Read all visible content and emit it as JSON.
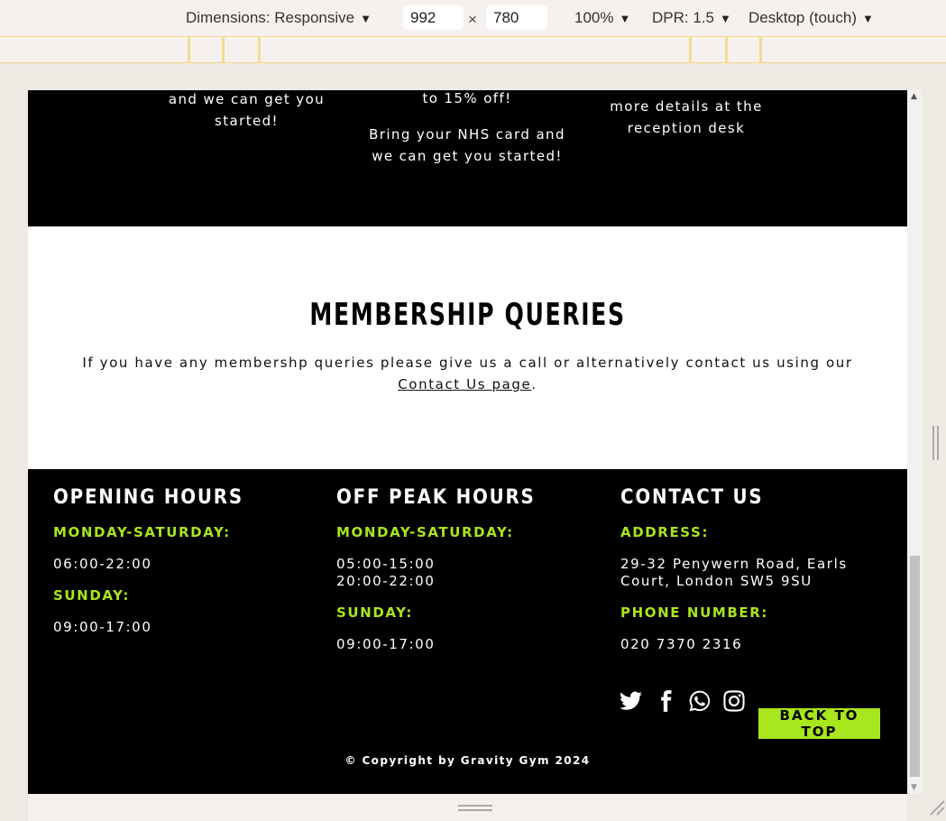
{
  "devtools": {
    "dimensions_label": "Dimensions: Responsive",
    "width_value": "992",
    "height_value": "780",
    "times_sign": "×",
    "zoom": "100%",
    "dpr": "DPR: 1.5",
    "device_mode": "Desktop (touch)",
    "caret": "▼"
  },
  "promos": {
    "col1": {
      "line1": "and we can get you",
      "line2": "started!"
    },
    "col2": {
      "line1": "to 15% off!",
      "line2": "Bring your NHS card and",
      "line3": "we can get you started!"
    },
    "col3": {
      "line1": "more details at the",
      "line2": "reception desk"
    }
  },
  "membership": {
    "title": "MEMBERSHIP QUERIES",
    "text": "If you have any membershp queries please give us a call or alternatively contact us using our ",
    "link": "Contact Us page",
    "end": "."
  },
  "footer": {
    "opening": {
      "title": "OPENING HOURS",
      "label1": "MONDAY-SATURDAY:",
      "value1": "06:00-22:00",
      "label2": "SUNDAY:",
      "value2": "09:00-17:00"
    },
    "offpeak": {
      "title": "OFF PEAK HOURS",
      "label1": "MONDAY-SATURDAY:",
      "value1a": "05:00-15:00",
      "value1b": "20:00-22:00",
      "label2": "SUNDAY:",
      "value2": "09:00-17:00"
    },
    "contact": {
      "title": "CONTACT US",
      "address_label": "ADDRESS:",
      "address_line1": "29-32 Penywern Road, Earls",
      "address_line2": "Court, London SW5 9SU",
      "phone_label": "PHONE NUMBER:",
      "phone": "020 7370 2316"
    },
    "socials": [
      "twitter-icon",
      "facebook-icon",
      "whatsapp-icon",
      "instagram-icon"
    ],
    "back_to_top": "BACK TO TOP",
    "copyright": "© Copyright by Gravity Gym 2024"
  },
  "colors": {
    "accent": "#a8e61d",
    "background_dark": "#000000",
    "background_light": "#ffffff"
  }
}
